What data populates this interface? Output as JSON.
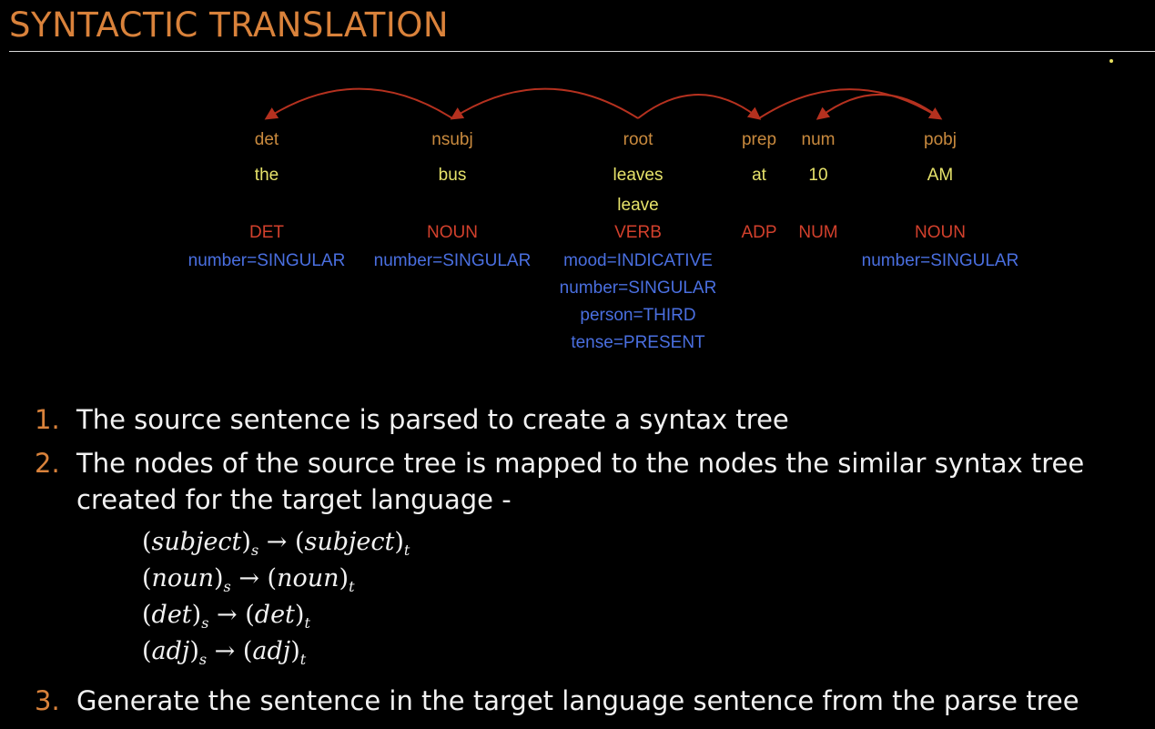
{
  "slide": {
    "title": "SYNTACTIC TRANSLATION"
  },
  "tree": {
    "tokens": [
      {
        "dep": "det",
        "word": "the",
        "lemma": "",
        "pos": "DET",
        "features": [
          "number=SINGULAR"
        ]
      },
      {
        "dep": "nsubj",
        "word": "bus",
        "lemma": "",
        "pos": "NOUN",
        "features": [
          "number=SINGULAR"
        ]
      },
      {
        "dep": "root",
        "word": "leaves",
        "lemma": "leave",
        "pos": "VERB",
        "features": [
          "mood=INDICATIVE",
          "number=SINGULAR",
          "person=THIRD",
          "tense=PRESENT"
        ]
      },
      {
        "dep": "prep",
        "word": "at",
        "lemma": "",
        "pos": "ADP",
        "features": []
      },
      {
        "dep": "num",
        "word": "10",
        "lemma": "",
        "pos": "NUM",
        "features": []
      },
      {
        "dep": "pobj",
        "word": "AM",
        "lemma": "",
        "pos": "NOUN",
        "features": [
          "number=SINGULAR"
        ]
      }
    ],
    "arcs": [
      {
        "head": 1,
        "dependent": 0
      },
      {
        "head": 2,
        "dependent": 1
      },
      {
        "head": 2,
        "dependent": 3
      },
      {
        "head": 3,
        "dependent": 5
      },
      {
        "head": 5,
        "dependent": 4
      }
    ],
    "colors": {
      "dep": "#c98a3e",
      "word": "#e6e26a",
      "pos": "#d2402c",
      "feature": "#4a6fe0",
      "arc": "#b5311f"
    }
  },
  "steps": [
    {
      "number": "1.",
      "line1": "The source sentence is parsed to create a syntax tree",
      "line2": ""
    },
    {
      "number": "2.",
      "line1": "The nodes of the source tree is mapped to the nodes the similar syntax tree",
      "line2": "created for the target language -"
    },
    {
      "number": "3.",
      "line1": "Generate the sentence in the target language sentence from the parse tree",
      "line2": ""
    }
  ],
  "mappings": [
    {
      "term": "subject",
      "src": "s",
      "tgt": "t"
    },
    {
      "term": "noun",
      "src": "s",
      "tgt": "t"
    },
    {
      "term": "det",
      "src": "s",
      "tgt": "t"
    },
    {
      "term": "adj",
      "src": "s",
      "tgt": "t"
    }
  ],
  "mapping_arrow": "→"
}
